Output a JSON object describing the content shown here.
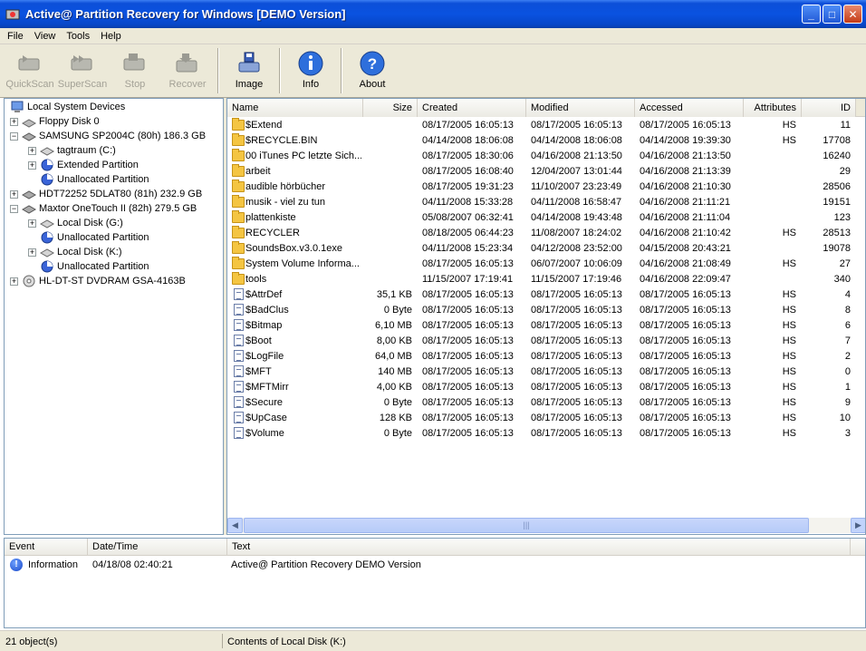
{
  "window": {
    "title": "Active@ Partition Recovery for Windows  [DEMO Version]",
    "minimize_label": "_",
    "maximize_label": "□",
    "close_label": "✕"
  },
  "menu": [
    "File",
    "View",
    "Tools",
    "Help"
  ],
  "toolbar": {
    "quickscan": "QuickScan",
    "superscan": "SuperScan",
    "stop": "Stop",
    "recover": "Recover",
    "image": "Image",
    "info": "Info",
    "about": "About"
  },
  "tree": [
    {
      "label": "Local System Devices",
      "level": 0,
      "expander": "",
      "icon": "computer-icon"
    },
    {
      "label": "Floppy Disk 0",
      "level": 1,
      "expander": "+",
      "icon": "floppy-icon"
    },
    {
      "label": "SAMSUNG SP2004C (80h) 186.3 GB",
      "level": 1,
      "expander": "−",
      "icon": "hard-disk-icon"
    },
    {
      "label": "tagtraum (C:)",
      "level": 2,
      "expander": "+",
      "icon": "drive-icon"
    },
    {
      "label": "Extended Partition",
      "level": 2,
      "expander": "+",
      "icon": "partition-icon"
    },
    {
      "label": "Unallocated Partition",
      "level": 2,
      "expander": "",
      "icon": "partition-icon"
    },
    {
      "label": "HDT72252 5DLAT80 (81h) 232.9 GB",
      "level": 1,
      "expander": "+",
      "icon": "hard-disk-icon"
    },
    {
      "label": "Maxtor OneTouch II (82h) 279.5 GB",
      "level": 1,
      "expander": "−",
      "icon": "hard-disk-icon"
    },
    {
      "label": "Local Disk (G:)",
      "level": 2,
      "expander": "+",
      "icon": "drive-icon"
    },
    {
      "label": "Unallocated Partition",
      "level": 2,
      "expander": "",
      "icon": "partition-icon"
    },
    {
      "label": "Local Disk (K:)",
      "level": 2,
      "expander": "+",
      "icon": "drive-icon"
    },
    {
      "label": "Unallocated Partition",
      "level": 2,
      "expander": "",
      "icon": "partition-icon"
    },
    {
      "label": "HL-DT-ST DVDRAM GSA-4163B",
      "level": 1,
      "expander": "+",
      "icon": "dvd-drive-icon"
    }
  ],
  "list_headers": {
    "name": "Name",
    "size": "Size",
    "created": "Created",
    "modified": "Modified",
    "accessed": "Accessed",
    "attributes": "Attributes",
    "id": "ID"
  },
  "files": [
    {
      "name": "$Extend",
      "type": "folder",
      "size": "",
      "created": "08/17/2005 16:05:13",
      "modified": "08/17/2005 16:05:13",
      "accessed": "08/17/2005 16:05:13",
      "attr": "HS",
      "id": "11"
    },
    {
      "name": "$RECYCLE.BIN",
      "type": "folder",
      "size": "",
      "created": "04/14/2008 18:06:08",
      "modified": "04/14/2008 18:06:08",
      "accessed": "04/14/2008 19:39:30",
      "attr": "HS",
      "id": "17708"
    },
    {
      "name": "00 iTunes PC letzte Sich...",
      "type": "folder",
      "size": "",
      "created": "08/17/2005 18:30:06",
      "modified": "04/16/2008 21:13:50",
      "accessed": "04/16/2008 21:13:50",
      "attr": "",
      "id": "16240"
    },
    {
      "name": "arbeit",
      "type": "folder",
      "size": "",
      "created": "08/17/2005 16:08:40",
      "modified": "12/04/2007 13:01:44",
      "accessed": "04/16/2008 21:13:39",
      "attr": "",
      "id": "29"
    },
    {
      "name": "audible hörbücher",
      "type": "folder",
      "size": "",
      "created": "08/17/2005 19:31:23",
      "modified": "11/10/2007 23:23:49",
      "accessed": "04/16/2008 21:10:30",
      "attr": "",
      "id": "28506"
    },
    {
      "name": "musik - viel zu tun",
      "type": "folder",
      "size": "",
      "created": "04/11/2008 15:33:28",
      "modified": "04/11/2008 16:58:47",
      "accessed": "04/16/2008 21:11:21",
      "attr": "",
      "id": "19151"
    },
    {
      "name": "plattenkiste",
      "type": "folder",
      "size": "",
      "created": "05/08/2007 06:32:41",
      "modified": "04/14/2008 19:43:48",
      "accessed": "04/16/2008 21:11:04",
      "attr": "",
      "id": "123"
    },
    {
      "name": "RECYCLER",
      "type": "folder",
      "size": "",
      "created": "08/18/2005 06:44:23",
      "modified": "11/08/2007 18:24:02",
      "accessed": "04/16/2008 21:10:42",
      "attr": "HS",
      "id": "28513"
    },
    {
      "name": "SoundsBox.v3.0.1exe",
      "type": "folder",
      "size": "",
      "created": "04/11/2008 15:23:34",
      "modified": "04/12/2008 23:52:00",
      "accessed": "04/15/2008 20:43:21",
      "attr": "",
      "id": "19078"
    },
    {
      "name": "System Volume Informa...",
      "type": "folder",
      "size": "",
      "created": "08/17/2005 16:05:13",
      "modified": "06/07/2007 10:06:09",
      "accessed": "04/16/2008 21:08:49",
      "attr": "HS",
      "id": "27"
    },
    {
      "name": "tools",
      "type": "folder",
      "size": "",
      "created": "11/15/2007 17:19:41",
      "modified": "11/15/2007 17:19:46",
      "accessed": "04/16/2008 22:09:47",
      "attr": "",
      "id": "340"
    },
    {
      "name": "$AttrDef",
      "type": "file",
      "size": "35,1 KB",
      "created": "08/17/2005 16:05:13",
      "modified": "08/17/2005 16:05:13",
      "accessed": "08/17/2005 16:05:13",
      "attr": "HS",
      "id": "4"
    },
    {
      "name": "$BadClus",
      "type": "file",
      "size": "0 Byte",
      "created": "08/17/2005 16:05:13",
      "modified": "08/17/2005 16:05:13",
      "accessed": "08/17/2005 16:05:13",
      "attr": "HS",
      "id": "8"
    },
    {
      "name": "$Bitmap",
      "type": "file",
      "size": "6,10 MB",
      "created": "08/17/2005 16:05:13",
      "modified": "08/17/2005 16:05:13",
      "accessed": "08/17/2005 16:05:13",
      "attr": "HS",
      "id": "6"
    },
    {
      "name": "$Boot",
      "type": "file",
      "size": "8,00 KB",
      "created": "08/17/2005 16:05:13",
      "modified": "08/17/2005 16:05:13",
      "accessed": "08/17/2005 16:05:13",
      "attr": "HS",
      "id": "7"
    },
    {
      "name": "$LogFile",
      "type": "file",
      "size": "64,0 MB",
      "created": "08/17/2005 16:05:13",
      "modified": "08/17/2005 16:05:13",
      "accessed": "08/17/2005 16:05:13",
      "attr": "HS",
      "id": "2"
    },
    {
      "name": "$MFT",
      "type": "file",
      "size": "140 MB",
      "created": "08/17/2005 16:05:13",
      "modified": "08/17/2005 16:05:13",
      "accessed": "08/17/2005 16:05:13",
      "attr": "HS",
      "id": "0"
    },
    {
      "name": "$MFTMirr",
      "type": "file",
      "size": "4,00 KB",
      "created": "08/17/2005 16:05:13",
      "modified": "08/17/2005 16:05:13",
      "accessed": "08/17/2005 16:05:13",
      "attr": "HS",
      "id": "1"
    },
    {
      "name": "$Secure",
      "type": "file",
      "size": "0 Byte",
      "created": "08/17/2005 16:05:13",
      "modified": "08/17/2005 16:05:13",
      "accessed": "08/17/2005 16:05:13",
      "attr": "HS",
      "id": "9"
    },
    {
      "name": "$UpCase",
      "type": "file",
      "size": "128 KB",
      "created": "08/17/2005 16:05:13",
      "modified": "08/17/2005 16:05:13",
      "accessed": "08/17/2005 16:05:13",
      "attr": "HS",
      "id": "10"
    },
    {
      "name": "$Volume",
      "type": "file",
      "size": "0 Byte",
      "created": "08/17/2005 16:05:13",
      "modified": "08/17/2005 16:05:13",
      "accessed": "08/17/2005 16:05:13",
      "attr": "HS",
      "id": "3"
    }
  ],
  "event_headers": {
    "event": "Event",
    "datetime": "Date/Time",
    "text": "Text"
  },
  "events": [
    {
      "event": "Information",
      "datetime": "04/18/08 02:40:21",
      "text": "Active@ Partition Recovery DEMO Version",
      "icon": "info-icon"
    }
  ],
  "status": {
    "objects": "21 object(s)",
    "contents": "Contents of Local Disk (K:)"
  }
}
